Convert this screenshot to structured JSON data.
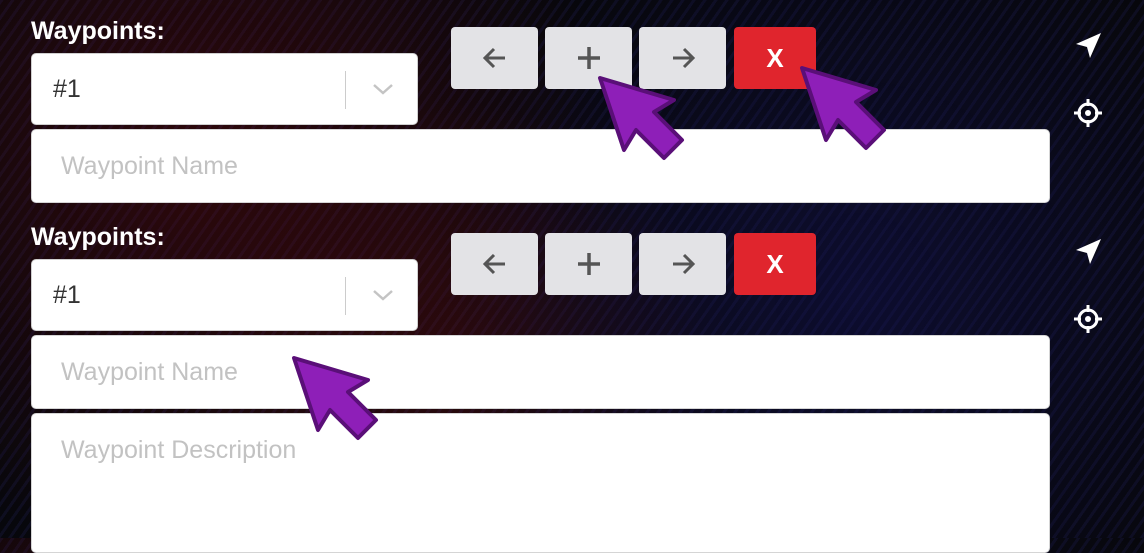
{
  "panels": [
    {
      "label": "Waypoints:",
      "select_value": "#1",
      "buttons": {
        "prev": "previous-waypoint",
        "add": "add-waypoint",
        "next": "next-waypoint",
        "delete": "X"
      },
      "name_placeholder": "Waypoint Name"
    },
    {
      "label": "Waypoints:",
      "select_value": "#1",
      "buttons": {
        "prev": "previous-waypoint",
        "add": "add-waypoint",
        "next": "next-waypoint",
        "delete": "X"
      },
      "name_placeholder": "Waypoint Name",
      "description_placeholder": "Waypoint Description"
    }
  ],
  "icons": {
    "prev": "arrow-left-icon",
    "add": "plus-icon",
    "next": "arrow-right-icon",
    "navigate": "navigation-arrow-icon",
    "locate": "crosshair-icon",
    "dropdown": "chevron-down-icon",
    "annotation": "pointer-arrow-icon"
  },
  "colors": {
    "delete_button": "#e0252d",
    "nav_button": "#e3e3e6",
    "annotation_arrow": "#8e1fb8",
    "label_text": "#ffffff"
  }
}
